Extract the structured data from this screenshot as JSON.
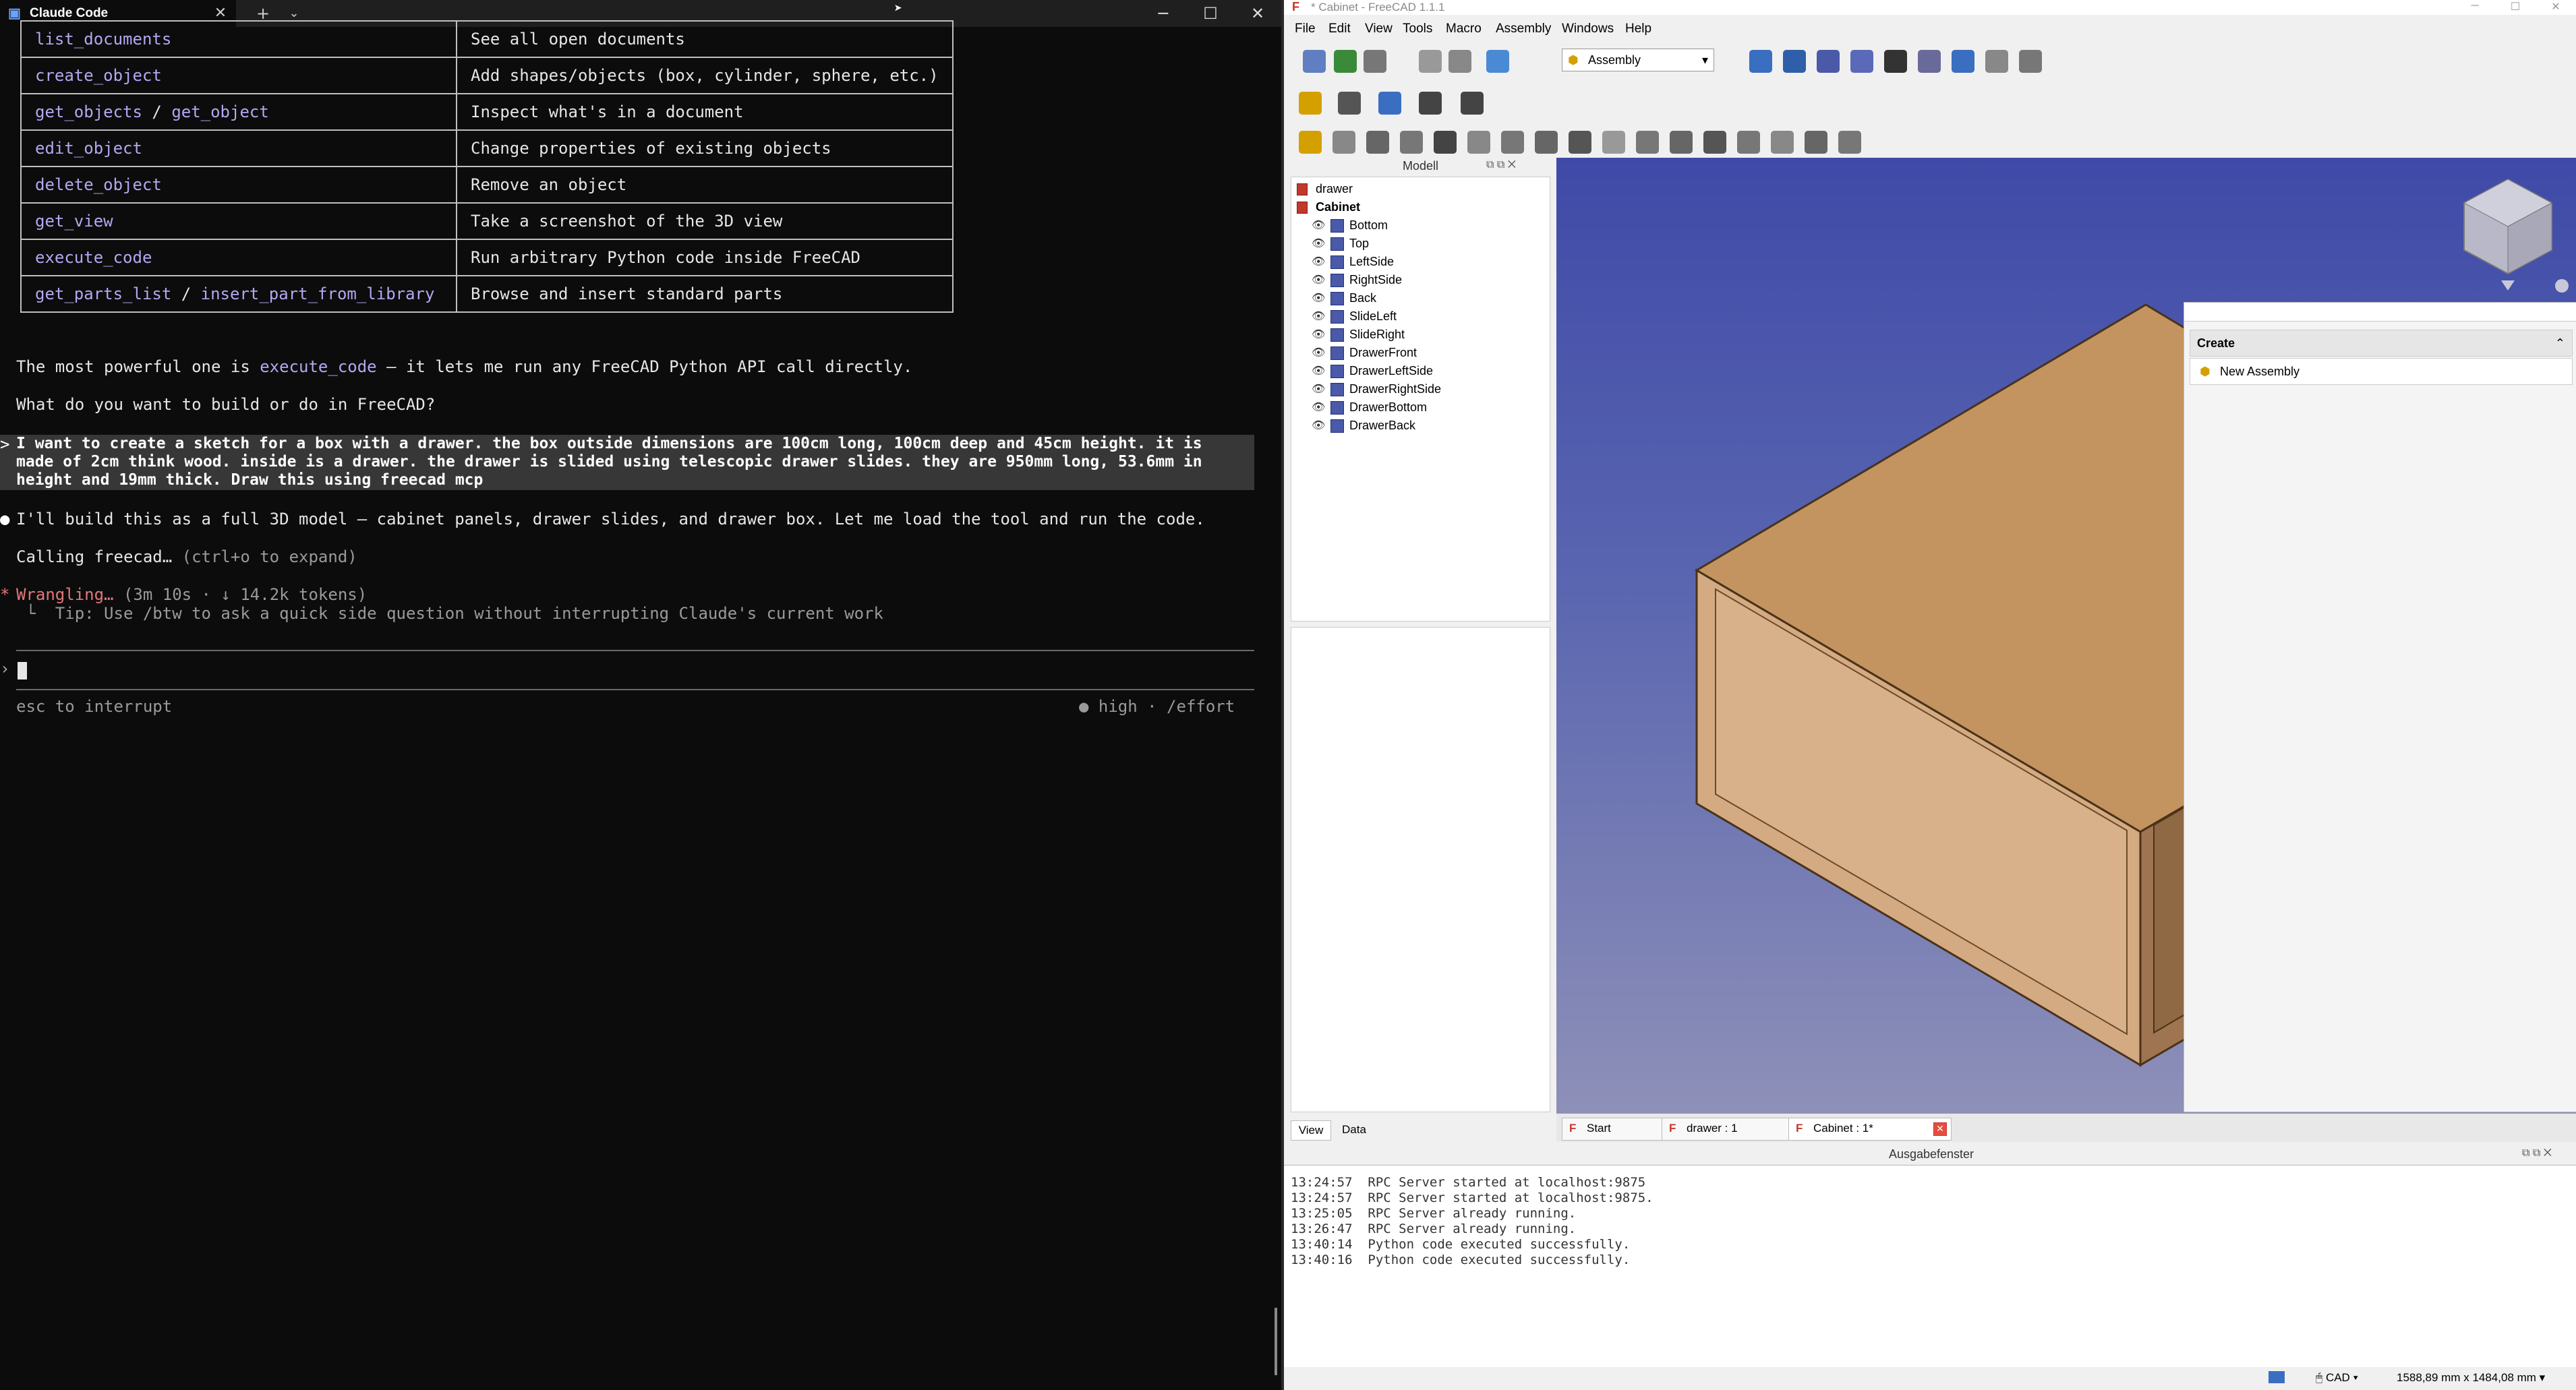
{
  "terminal": {
    "tab_title": "Claude Code",
    "table": [
      {
        "cmd": "list_documents",
        "desc": "See all open documents"
      },
      {
        "cmd": "create_object",
        "desc": "Add shapes/objects (box, cylinder, sphere, etc.)"
      },
      {
        "cmd": "get_objects",
        "cmd_sep": " / ",
        "cmd2": "get_object",
        "desc": "Inspect what's in a document"
      },
      {
        "cmd": "edit_object",
        "desc": "Change properties of existing objects"
      },
      {
        "cmd": "delete_object",
        "desc": "Remove an object"
      },
      {
        "cmd": "get_view",
        "desc": "Take a screenshot of the 3D view"
      },
      {
        "cmd": "execute_code",
        "desc": "Run arbitrary Python code inside FreeCAD"
      },
      {
        "cmd": "get_parts_list",
        "cmd_sep": " / ",
        "cmd2": "insert_part_from_library",
        "desc": "Browse and insert standard parts"
      }
    ],
    "powerful_prefix": "The most powerful one is ",
    "powerful_cmd": "execute_code",
    "powerful_suffix": " — it lets me run any FreeCAD Python API call directly.",
    "question": "What do you want to build or do in FreeCAD?",
    "user_lines": [
      "I want to create a sketch for a box with a drawer. the box outside dimensions are 100cm long, 100cm deep and 45cm height. it is",
      "made of 2cm think wood. inside is a drawer. the drawer is slided using telescopic drawer slides. they are 950mm long, 53.6mm in",
      "height and 19mm thick. Draw this using freecad mcp"
    ],
    "reply": "I'll build this as a full 3D model — cabinet panels, drawer slides, and drawer box. Let me load the tool and run the code.",
    "calling": "Calling freecad…",
    "calling_hint": " (ctrl+o to expand)",
    "wrangling": "Wrangling…",
    "wrangling_stats": " (3m 10s · ↓ 14.2k tokens)",
    "tip": " └  Tip: Use /btw to ask a quick side question without interrupting Claude's current work",
    "esc_hint": "esc to interrupt",
    "effort": "● high · /effort"
  },
  "freecad": {
    "title": "* Cabinet - FreeCAD 1.1.1",
    "menu": [
      "File",
      "Edit",
      "View",
      "Tools",
      "Macro",
      "Assembly",
      "Windows",
      "Help"
    ],
    "workbench": "Assembly",
    "model_panel_title": "Modell",
    "tree": {
      "root1": "drawer",
      "root2": "Cabinet",
      "children": [
        "Bottom",
        "Top",
        "LeftSide",
        "RightSide",
        "Back",
        "SlideLeft",
        "SlideRight",
        "DrawerFront",
        "DrawerLeftSide",
        "DrawerRightSide",
        "DrawerBottom",
        "DrawerBack"
      ]
    },
    "prop_tabs": [
      "View",
      "Data"
    ],
    "create_panel": {
      "header": "Create",
      "item": "New Assembly"
    },
    "doc_tabs": [
      "Start",
      "drawer : 1",
      "Cabinet : 1*"
    ],
    "report_title": "Ausgabefenster",
    "log": [
      "13:24:57  RPC Server started at localhost:9875",
      "13:24:57  RPC Server started at localhost:9875.",
      "13:25:05  RPC Server already running.",
      "13:26:47  RPC Server already running.",
      "13:40:14  Python code executed successfully.",
      "13:40:16  Python code executed successfully."
    ],
    "status_nav": "CAD",
    "status_dims": "1588,89 mm x 1484,08 mm"
  },
  "colors": {
    "terminal_bg": "#0c0c0c",
    "command_purple": "#b4a7f2",
    "wrangle_red": "#e2777a",
    "wood_top": "#c39460",
    "wood_front": "#d3aa82",
    "wood_side": "#9e7550",
    "viewport_top": "#3f4aa8",
    "viewport_bottom": "#8e90b8"
  }
}
